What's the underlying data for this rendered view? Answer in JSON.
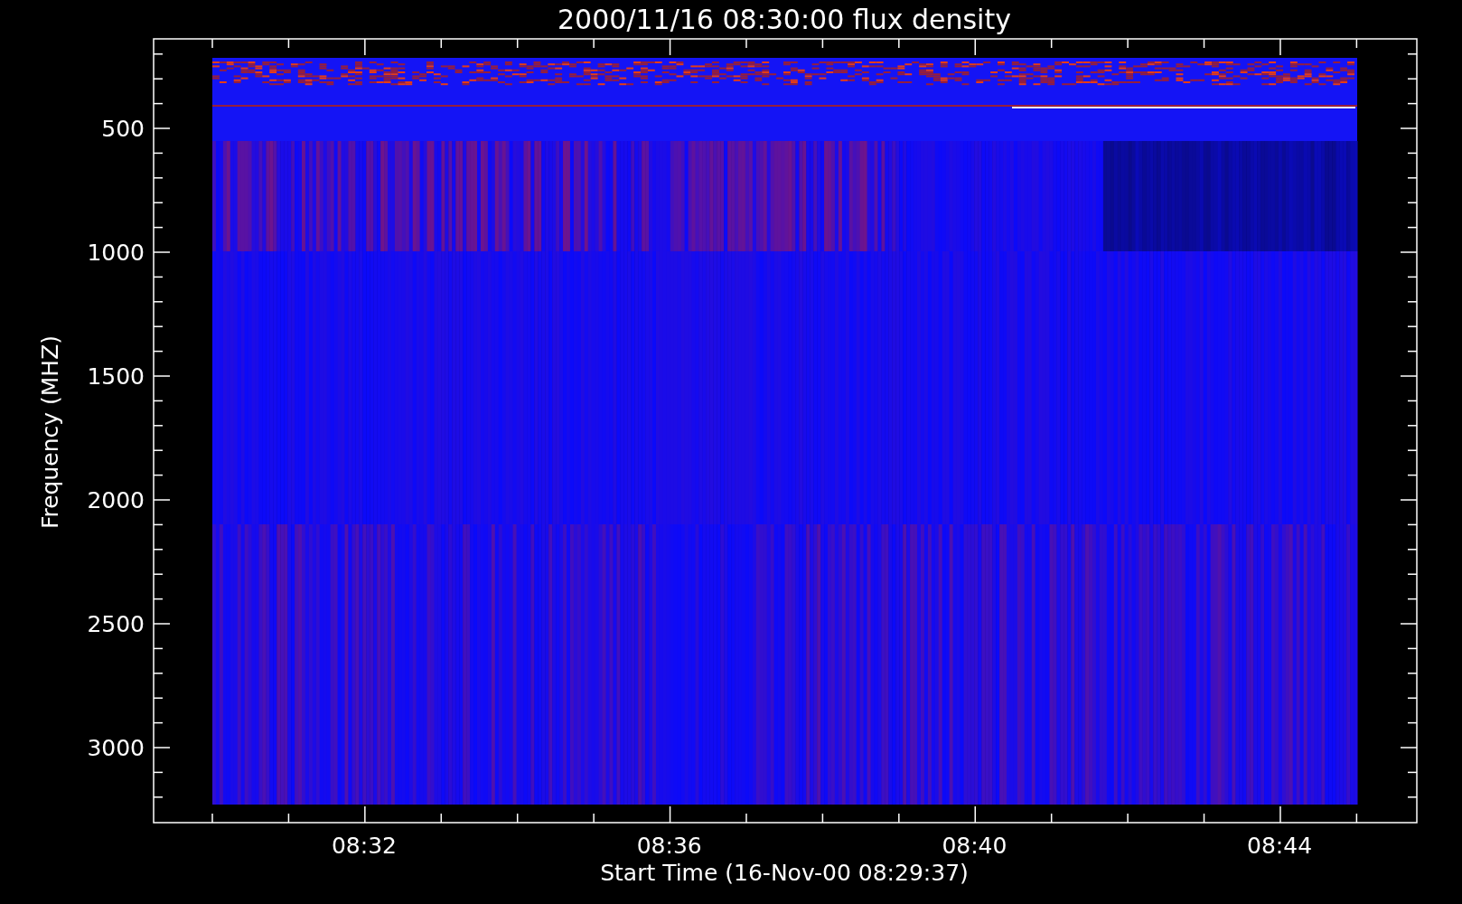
{
  "plot": {
    "title": "2000/11/16 08:30:00 flux density",
    "ylabel": "Frequency (MHZ)",
    "xlabel": "Start Time (16-Nov-00 08:29:37)",
    "yticks": [
      "500",
      "1000",
      "1500",
      "2000",
      "2500",
      "3000"
    ],
    "xticks": [
      "08:32",
      "08:36",
      "08:40",
      "08:44"
    ]
  }
}
